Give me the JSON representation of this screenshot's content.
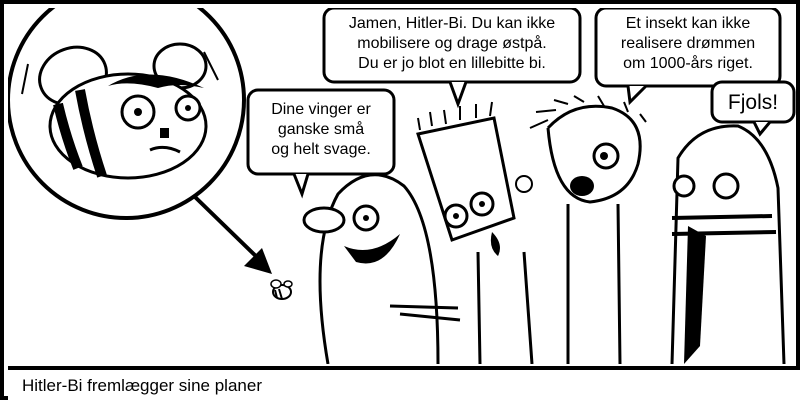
{
  "comic": {
    "caption": "Hitler-Bi fremlægger sine planer",
    "bubbles": {
      "first": [
        "Dine vinger er",
        "ganske små",
        "og helt svage."
      ],
      "second": [
        "Jamen, Hitler-Bi. Du kan ikke",
        "mobilisere og drage østpå.",
        "Du er jo blot en lillebitte bi."
      ],
      "third": [
        "Et insekt kan ikke",
        "realisere drømmen",
        "om 1000-års riget."
      ],
      "fourth": [
        "Fjols!"
      ]
    }
  }
}
